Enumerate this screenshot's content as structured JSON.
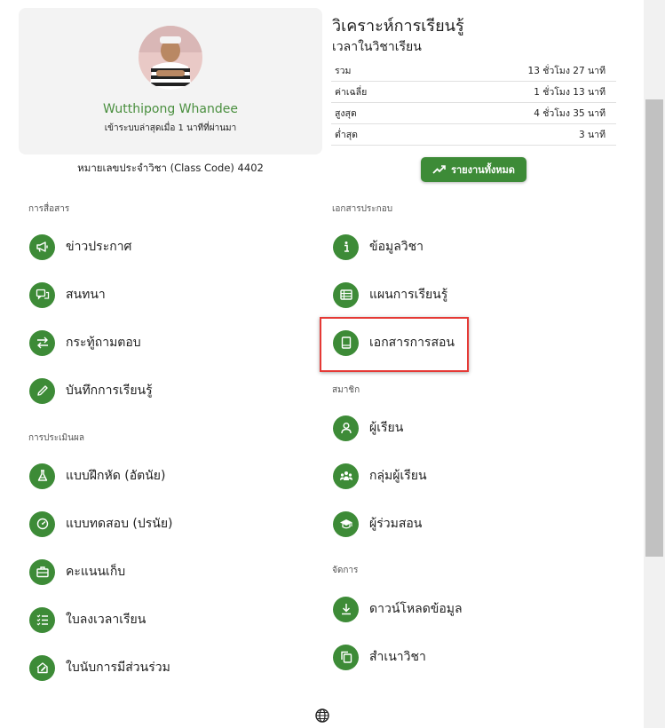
{
  "profile": {
    "name": "Wutthipong Whandee",
    "last_login": "เข้าระบบล่าสุดเมื่อ 1 นาทีที่ผ่านมา",
    "class_code": "หมายเลขประจำวิชา (Class Code) 4402"
  },
  "analytics": {
    "title": "วิเคราะห์การเรียนรู้",
    "subtitle": "เวลาในวิชาเรียน",
    "rows": [
      {
        "label": "รวม",
        "value": "13 ชั่วโมง 27 นาที"
      },
      {
        "label": "ค่าเฉลี่ย",
        "value": "1 ชั่วโมง 13 นาที"
      },
      {
        "label": "สูงสุด",
        "value": "4 ชั่วโมง 35 นาที"
      },
      {
        "label": "ต่ำสุด",
        "value": "3 นาที"
      }
    ],
    "report_button": "รายงานทั้งหมด"
  },
  "sections": {
    "communication": "การสื่อสาร",
    "assessment": "การประเมินผล",
    "documents": "เอกสารประกอบ",
    "members": "สมาชิก",
    "manage": "จัดการ"
  },
  "menu": {
    "news": "ข่าวประกาศ",
    "chat": "สนทนา",
    "qa": "กระทู้ถามตอบ",
    "learning_log": "บันทึกการเรียนรู้",
    "exercise": "แบบฝึกหัด (อัตนัย)",
    "quiz": "แบบทดสอบ (ปรนัย)",
    "scores": "คะแนนเก็บ",
    "attendance": "ใบลงเวลาเรียน",
    "participation": "ใบนับการมีส่วนร่วม",
    "course_info": "ข้อมูลวิชา",
    "lesson_plan": "แผนการเรียนรู้",
    "teaching_docs": "เอกสารการสอน",
    "students": "ผู้เรียน",
    "student_groups": "กลุ่มผู้เรียน",
    "co_teachers": "ผู้ร่วมสอน",
    "download": "ดาวน์โหลดข้อมูล",
    "copy_course": "สำเนาวิชา"
  },
  "colors": {
    "accent": "#3d8b37",
    "name": "#4a8f3f",
    "highlight": "#e53935"
  }
}
